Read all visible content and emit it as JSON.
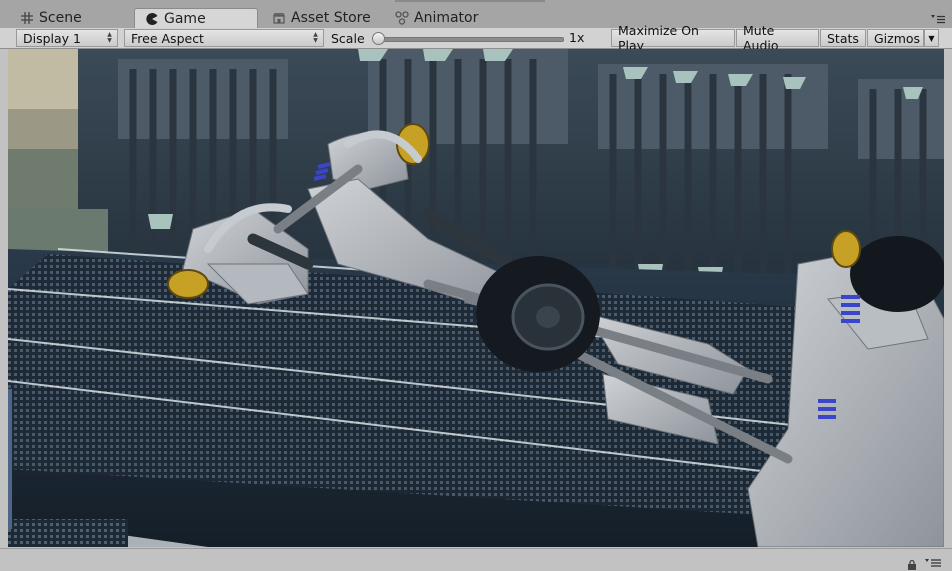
{
  "tabs": [
    {
      "label": "Scene",
      "icon": "grid-icon"
    },
    {
      "label": "Game",
      "icon": "pacman-icon",
      "active": true
    },
    {
      "label": "Asset Store",
      "icon": "store-icon"
    },
    {
      "label": "Animator",
      "icon": "animator-icon"
    }
  ],
  "toolbar": {
    "display": "Display 1",
    "aspect": "Free Aspect",
    "scale_label": "Scale",
    "scale_value": "1x",
    "maximize_on_play": "Maximize On Play",
    "mute_audio": "Mute Audio",
    "stats": "Stats",
    "gizmos": "Gizmos"
  },
  "colors": {
    "panel": "#c2c2c2",
    "tab_strip": "#a5a5a5",
    "toolbar": "#d2d2d2",
    "scene_bg": "#18222c"
  }
}
